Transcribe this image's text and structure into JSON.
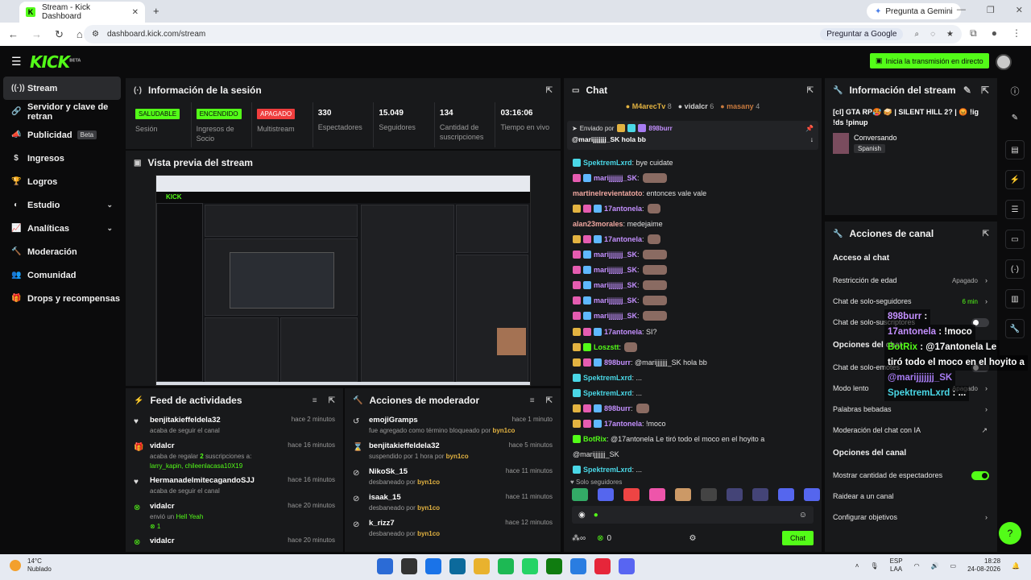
{
  "browser": {
    "tab_title": "Stream - Kick Dashboard",
    "gemini_button": "Pregunta a Gemini",
    "url": "dashboard.kick.com/stream",
    "google_button": "Preguntar a Google"
  },
  "header": {
    "logo": "KICK",
    "logo_tag": "BETA",
    "go_live": "Inicia la transmisión en directo"
  },
  "sidebar": {
    "items": [
      {
        "label": "Stream",
        "icon": "broadcast-icon"
      },
      {
        "label": "Servidor y clave de retran",
        "icon": "link-icon"
      },
      {
        "label": "Publicidad",
        "icon": "megaphone-icon",
        "badge": "Beta"
      },
      {
        "label": "Ingresos",
        "icon": "money-icon"
      },
      {
        "label": "Logros",
        "icon": "trophy-icon"
      },
      {
        "label": "Estudio",
        "icon": "studio-icon"
      },
      {
        "label": "Analíticas",
        "icon": "chart-icon"
      },
      {
        "label": "Moderación",
        "icon": "hammer-icon"
      },
      {
        "label": "Comunidad",
        "icon": "community-icon"
      },
      {
        "label": "Drops y recompensas",
        "icon": "gift-icon"
      }
    ]
  },
  "session": {
    "title": "Información de la sesión",
    "stats": [
      {
        "badge": "SALUDABLE",
        "label": "Sesión",
        "color": "green"
      },
      {
        "badge": "ENCENDIDO",
        "label": "Ingresos de Socio",
        "color": "green"
      },
      {
        "badge": "APAGADO",
        "label": "Multistream",
        "color": "red"
      },
      {
        "value": "330",
        "label": "Espectadores"
      },
      {
        "value": "15.049",
        "label": "Seguidores"
      },
      {
        "value": "134",
        "label": "Cantidad de suscripciones"
      },
      {
        "value": "03:16:06",
        "label": "Tiempo en vivo"
      }
    ]
  },
  "preview": {
    "title": "Vista previa del stream"
  },
  "feed": {
    "title": "Feed de actividades",
    "items": [
      {
        "name": "benjitakieffeldela32",
        "sub": "acaba de seguir el canal",
        "time": "hace 2 minutos",
        "icon": "heart-icon"
      },
      {
        "name": "vidalcr",
        "sub_pre": "acaba de regalar ",
        "sub_num": "2",
        "sub_post": " suscripciones a:",
        "users": "larry_kapin, chileenlacasa10X19",
        "time": "hace 16 minutos",
        "icon": "gift-icon"
      },
      {
        "name": "HermanadelmitecagandoSJJ",
        "sub": "acaba de seguir el canal",
        "time": "hace 16 minutos",
        "icon": "heart-icon"
      },
      {
        "name": "vidalcr",
        "sub_pre": "envió un ",
        "sub_link": "Hell Yeah",
        "count": "1",
        "time": "hace 20 minutos",
        "icon": "kick-icon"
      },
      {
        "name": "vidalcr",
        "time": "hace 20 minutos",
        "icon": "kick-icon"
      }
    ]
  },
  "modactions": {
    "title": "Acciones de moderador",
    "items": [
      {
        "name": "emojiGramps",
        "sub": "fue agregado como término bloqueado por",
        "by": "byn1co",
        "time": "hace 1 minuto",
        "icon": "history-icon"
      },
      {
        "name": "benjitakieffeldela32",
        "sub": "suspendido por 1 hora por",
        "by": "byn1co",
        "time": "hace 5 minutos",
        "icon": "hourglass-icon"
      },
      {
        "name": "NikoSk_15",
        "sub": "desbaneado por",
        "by": "byn1co",
        "time": "hace 11 minutos",
        "icon": "unban-icon"
      },
      {
        "name": "isaak_15",
        "sub": "desbaneado por",
        "by": "byn1co",
        "time": "hace 11 minutos",
        "icon": "unban-icon"
      },
      {
        "name": "k_rizz7",
        "sub": "desbaneado por",
        "by": "byn1co",
        "time": "hace 12 minutos",
        "icon": "unban-icon"
      }
    ]
  },
  "chat": {
    "title": "Chat",
    "top": [
      {
        "name": "M4arecTv",
        "count": "8"
      },
      {
        "name": "vidalcr",
        "count": "6"
      },
      {
        "name": "masany",
        "count": "4"
      }
    ],
    "pinned": {
      "label": "Enviado por",
      "user": "898burr",
      "text": "@marijjjjjjj_SK hola bb"
    },
    "messages": [
      {
        "user": "SpektremLxrd",
        "color": "cyan",
        "text": ": bye cuidate"
      },
      {
        "user": "marijjjjjjj_SK",
        "color": "purple",
        "emote": true
      },
      {
        "user": "martinelrevientatoto",
        "color": "peach",
        "text": ": entonces vale vale"
      },
      {
        "user": "17antonela",
        "color": "purple",
        "emote": true,
        "small": true
      },
      {
        "user": "alan23morales",
        "color": "peach",
        "text": ": medejaime"
      },
      {
        "user": "17antonela",
        "color": "purple",
        "emote": true,
        "small": true
      },
      {
        "user": "marijjjjjjj_SK",
        "color": "purple",
        "emote": true
      },
      {
        "user": "marijjjjjjj_SK",
        "color": "purple",
        "emote": true
      },
      {
        "user": "marijjjjjjj_SK",
        "color": "purple",
        "emote": true
      },
      {
        "user": "marijjjjjjj_SK",
        "color": "purple",
        "emote": true
      },
      {
        "user": "marijjjjjjj_SK",
        "color": "purple",
        "emote": true
      },
      {
        "user": "17antonela",
        "color": "purple",
        "text": ": SI?"
      },
      {
        "user": "Loszstt",
        "color": "green",
        "emote": true,
        "small": true
      },
      {
        "user": "898burr",
        "color": "purple",
        "text": ": @marijjjjjjj_SK hola bb"
      },
      {
        "user": "SpektremLxrd",
        "color": "cyan",
        "text": ": ..."
      },
      {
        "user": "SpektremLxrd",
        "color": "cyan",
        "text": ": ..."
      },
      {
        "user": "898burr",
        "color": "purple",
        "emote": true,
        "small": true
      },
      {
        "user": "17antonela",
        "color": "purple",
        "text": ": !moco"
      },
      {
        "user": "BotRix",
        "color": "green",
        "text": ": @17antonela Le tiró todo el moco en el hoyito a"
      },
      {
        "user": "",
        "color": "",
        "text": "@marijjjjjjj_SK"
      },
      {
        "user": "SpektremLxrd",
        "color": "cyan",
        "text": ": ..."
      }
    ],
    "followers_only": "Solo seguidores",
    "emote_bar": [
      "#3a6",
      "#56e",
      "#e44",
      "#e5a",
      "#c96",
      "#444",
      "#447",
      "#447",
      "#56e",
      "#56e"
    ],
    "count": "0",
    "send": "Chat"
  },
  "stream_info": {
    "title": "Información del stream",
    "stream_title": "[cl] GTA RP🥵 🥪 | SILENT HILL 2? | 😡 !ig !ds !pinup",
    "category": "Conversando",
    "language": "Spanish"
  },
  "channel_actions": {
    "title": "Acciones de canal",
    "sections": [
      {
        "heading": "Acceso al chat",
        "rows": [
          {
            "label": "Restricción de edad",
            "value": "Apagado",
            "arrow": true
          },
          {
            "label": "Chat de solo-seguidores",
            "value": "6 min",
            "value_color": "#53fc18",
            "arrow": true
          },
          {
            "label": "Chat de solo-suscriptores",
            "toggle": false
          }
        ]
      },
      {
        "heading": "Opciones del chat",
        "rows": [
          {
            "label": "Chat de solo-emotes",
            "toggle": false
          },
          {
            "label": "Modo lento",
            "value": "Apagado",
            "arrow": true
          },
          {
            "label": "Palabras bebadas",
            "arrow": true
          },
          {
            "label": "Moderación del chat con IA",
            "ext": true
          }
        ]
      },
      {
        "heading": "Opciones del canal",
        "rows": [
          {
            "label": "Mostrar cantidad de espectadores",
            "toggle": true
          },
          {
            "label": "Raidear a un canal"
          },
          {
            "label": "Configurar objetivos",
            "arrow": true
          }
        ]
      }
    ]
  },
  "overlay": [
    {
      "user": "898burr",
      "text": " : "
    },
    {
      "user": "17antonela",
      "text": " : !moco"
    },
    {
      "user": "BotRix",
      "text": " : @17antonela Le"
    },
    {
      "user": "",
      "text": "tiró todo el moco en el hoyito a"
    },
    {
      "user": "@marijjjjjjj_SK",
      "text": ""
    },
    {
      "user": "SpektremLxrd",
      "text": " : ..."
    }
  ],
  "taskbar": {
    "temp": "14°C",
    "weather": "Nublado",
    "lang1": "ESP",
    "lang2": "LAA",
    "time": "18:28",
    "date": "24-08-2026",
    "icons": [
      "#2b6bd6",
      "#333",
      "#1a73e8",
      "#0c6a9c",
      "#e9b22e",
      "#1db954",
      "#25d366",
      "#107c10",
      "#2a7de1",
      "#e6263a",
      "#5865f2"
    ]
  },
  "colors": {
    "accent": "#53fc18",
    "panel": "#18191b",
    "bg": "#0b0b0c"
  }
}
